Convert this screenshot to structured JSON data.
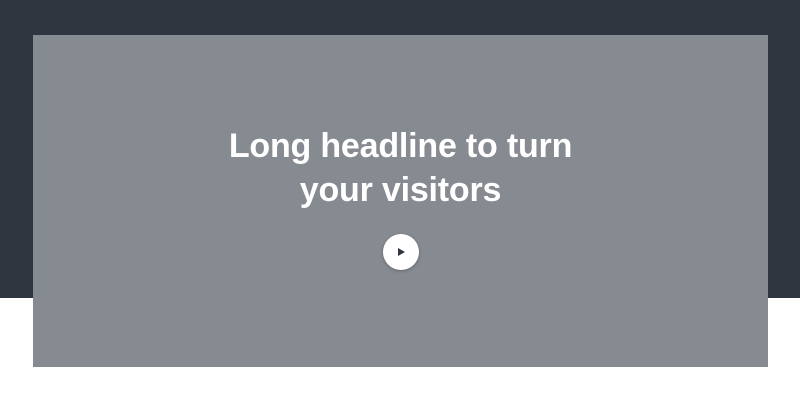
{
  "hero": {
    "headline": "Long headline to turn your visitors",
    "play_icon": "play-icon",
    "colors": {
      "top_band": "#2f3640",
      "video_card": "#868a91",
      "headline_text": "#ffffff",
      "play_button": "#ffffff",
      "play_glyph": "#2f3640"
    }
  }
}
